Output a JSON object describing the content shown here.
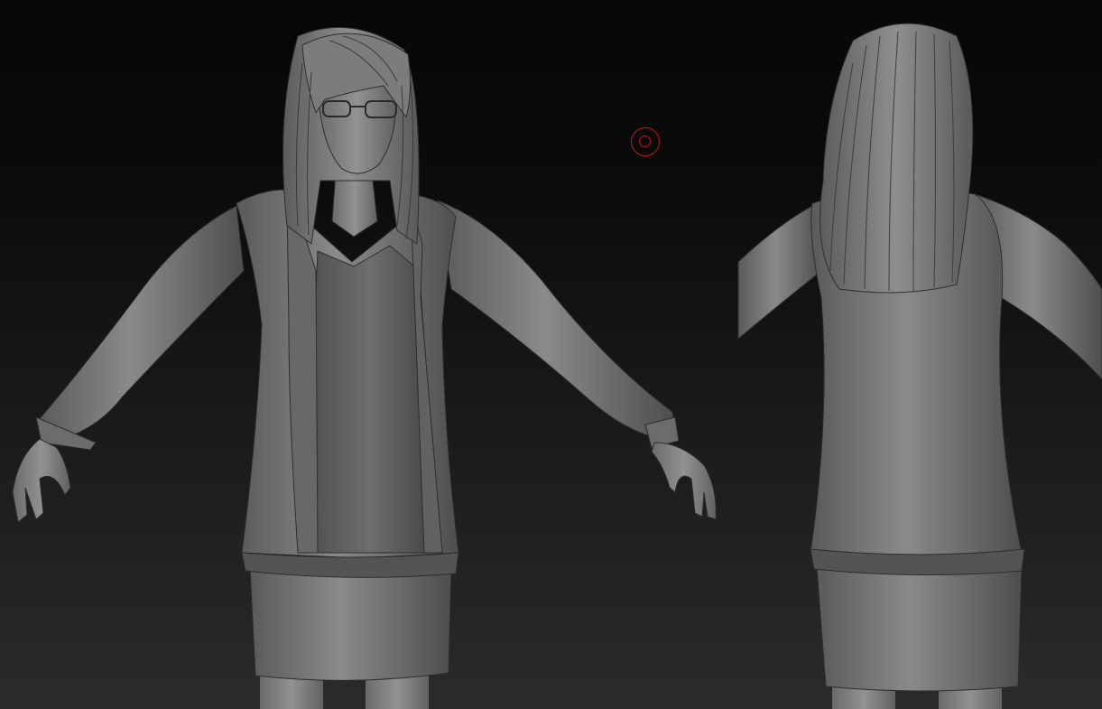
{
  "app": {
    "name": "",
    "viewport_background": "#0b0b0b"
  },
  "viewport": {
    "objects": [
      {
        "name": "character-front-view",
        "material_color": "#7a7a7a"
      },
      {
        "name": "character-back-view",
        "material_color": "#7a7a7a"
      }
    ],
    "cursor": {
      "icon": "brush-cursor-icon",
      "color": "#c01818"
    }
  }
}
